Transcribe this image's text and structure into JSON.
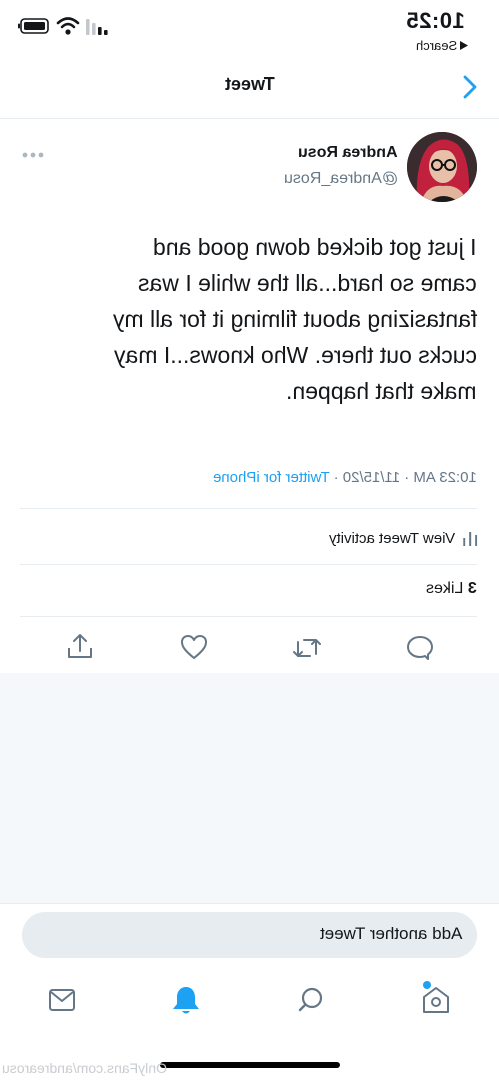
{
  "status_bar": {
    "time": "10:25",
    "back_app": "Search",
    "back_icon": "triangle-left-icon",
    "icons": [
      "battery-icon",
      "wifi-icon",
      "cellular-signal-icon"
    ]
  },
  "nav": {
    "title": "Tweet",
    "back_icon": "chevron-back-icon"
  },
  "tweet": {
    "author_name": "Andrea Rosu",
    "author_handle": "@Andrea_Rosu",
    "more_icon": "more-dots-icon",
    "text_lines": [
      "I just got dicked down good and",
      "came so hard...all the while I was",
      "fantasizing about filming it for all my",
      "cucks out there. Who knows...I may",
      "make that happen."
    ],
    "time": "10:23 AM",
    "date": "11/15/20",
    "source": "Twitter for iPhone",
    "separator": "·",
    "activity_label": "View Tweet activity",
    "likes_count": "3",
    "likes_label": "Likes",
    "actions": [
      "reply-icon",
      "retweet-icon",
      "like-icon",
      "share-icon"
    ]
  },
  "compose": {
    "placeholder": "Add another Tweet"
  },
  "tab_bar": {
    "items": [
      {
        "icon": "home-icon",
        "has_dot": true
      },
      {
        "icon": "search-icon"
      },
      {
        "icon": "notifications-bell-icon",
        "active": true
      },
      {
        "icon": "messages-mail-icon"
      }
    ]
  },
  "watermark": "OnlyFans.com/andrearosu",
  "colors": {
    "accent": "#1da1f2",
    "secondary_text": "#657786",
    "divider": "#e6ecf0",
    "background_gray": "#f5f8fa"
  }
}
